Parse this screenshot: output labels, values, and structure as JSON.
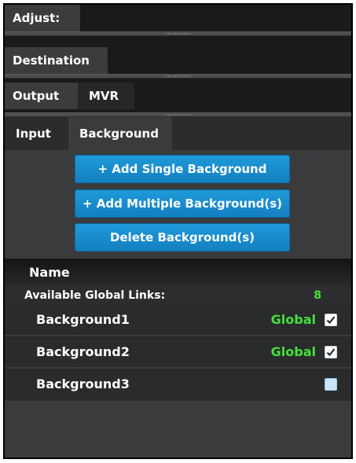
{
  "panels": {
    "adjust_tab": "Adjust:",
    "destination_tab": "Destination",
    "output_tab": "Output",
    "mvr_tab": "MVR"
  },
  "subtabs": {
    "input": "Input",
    "background": "Background"
  },
  "actions": {
    "add_single": "+ Add Single Background",
    "add_multiple": "+ Add Multiple Background(s)",
    "delete": "Delete Background(s)"
  },
  "list": {
    "header": "Name",
    "available_global_links_label": "Available Global Links:",
    "available_global_links_count": "8",
    "rows": [
      {
        "name": "Background1",
        "global_label": "Global",
        "checked": true
      },
      {
        "name": "Background2",
        "global_label": "Global",
        "checked": true
      },
      {
        "name": "Background3",
        "global_label": "",
        "checked": false
      }
    ]
  },
  "colors": {
    "accent_blue": "#1a8fd0",
    "global_green": "#45e03a",
    "panel_bg": "#3a3b3d",
    "dark_strip": "#1a1a1b"
  },
  "icons": {
    "checked": "checkbox-checked-icon",
    "unchecked": "checkbox-unchecked-icon",
    "grip": "resize-grip-icon"
  }
}
